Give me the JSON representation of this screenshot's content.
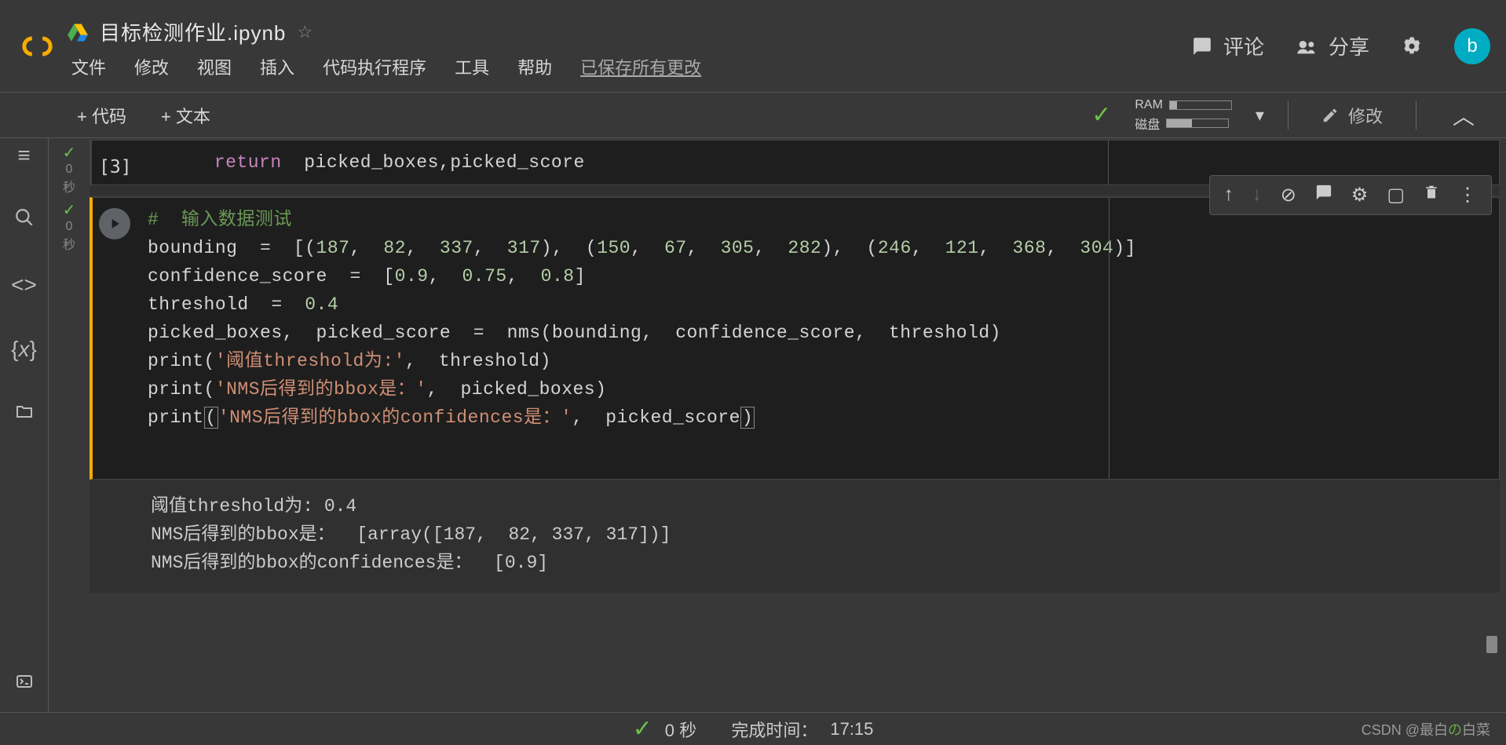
{
  "header": {
    "file_title": "目标检测作业.ipynb",
    "comment_label": "评论",
    "share_label": "分享",
    "avatar_letter": "b"
  },
  "menu": {
    "file": "文件",
    "edit": "修改",
    "view": "视图",
    "insert": "插入",
    "runtime": "代码执行程序",
    "tools": "工具",
    "help": "帮助",
    "saved": "已保存所有更改"
  },
  "toolbar": {
    "code_btn": "+ 代码",
    "text_btn": "+ 文本",
    "ram_label": "RAM",
    "disk_label": "磁盘",
    "edit_label": "修改"
  },
  "cell1": {
    "kw_return": "return",
    "rest": "  picked_boxes,picked_score",
    "brackets": "[3]"
  },
  "cell2": {
    "comment": "#  输入数据测试",
    "line2": "bounding  =  [(187,  82,  337,  317),  (150,  67,  305,  282),  (246,  121,  368,  304)]",
    "line3": "confidence_score  =  [0.9,  0.75,  0.8]",
    "line4": "threshold  =  0.4",
    "line5": "picked_boxes,  picked_score  =  nms(bounding,  confidence_score,  threshold)",
    "print1_pre": "print(",
    "print1_str": "'阈值threshold为:'",
    "print1_post": ",  threshold)",
    "print2_pre": "print(",
    "print2_str": "'NMS后得到的bbox是：'",
    "print2_post": ",  picked_boxes)",
    "print3_pre": "print",
    "print3_str": "'NMS后得到的bbox的confidences是：'",
    "print3_post": ",  picked_score",
    "output1": "阈值threshold为: 0.4",
    "output2": "NMS后得到的bbox是：  [array([187,  82, 337, 317])]",
    "output3": "NMS后得到的bbox的confidences是：  [0.9]"
  },
  "status": {
    "time": "0 秒",
    "done_label": "完成时间：",
    "done_time": "17:15"
  },
  "watermark": {
    "left": "CSDN @最白",
    "mid": "の",
    "right": "白菜"
  },
  "gutter": {
    "zero": "0",
    "sec": "秒"
  }
}
